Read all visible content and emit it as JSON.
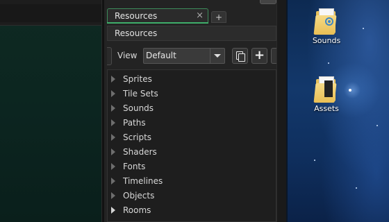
{
  "panel": {
    "tab_label": "Resources",
    "tab_close": "×",
    "tab_add": "+",
    "header_title": "Resources",
    "view_label": "View",
    "view_select_value": "Default",
    "add_button": "+"
  },
  "tree": {
    "items": [
      {
        "label": "Sprites"
      },
      {
        "label": "Tile Sets"
      },
      {
        "label": "Sounds"
      },
      {
        "label": "Paths"
      },
      {
        "label": "Scripts"
      },
      {
        "label": "Shaders"
      },
      {
        "label": "Fonts"
      },
      {
        "label": "Timelines"
      },
      {
        "label": "Objects"
      },
      {
        "label": "Rooms"
      }
    ]
  },
  "desktop": {
    "icons": [
      {
        "label": "Sounds",
        "icon": "folder-audio-icon"
      },
      {
        "label": "Assets",
        "icon": "folder-document-icon"
      }
    ]
  },
  "colors": {
    "panel_bg": "#232323",
    "tab_accent": "#3fae6a",
    "desktop_bg": "#13386b"
  }
}
